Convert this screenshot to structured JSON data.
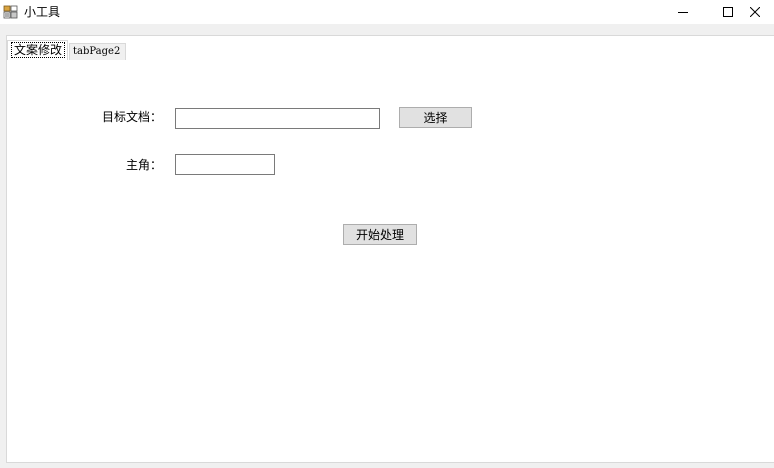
{
  "window": {
    "title": "小工具",
    "icon": "app-icon",
    "controls": {
      "minimize": "minimize-icon",
      "maximize": "maximize-icon",
      "close": "close-icon"
    }
  },
  "tabs": [
    {
      "label": "文案修改",
      "selected": true
    },
    {
      "label": "tabPage2",
      "selected": false
    }
  ],
  "form": {
    "target_doc_label": "目标文档：",
    "target_doc_value": "",
    "select_button": "选择",
    "protagonist_label": "主角：",
    "protagonist_value": "",
    "start_button": "开始处理"
  },
  "colors": {
    "form_background": "#f0f0f0",
    "panel_background": "#ffffff",
    "button_background": "#e1e1e1",
    "border": "#7a7a7a"
  }
}
